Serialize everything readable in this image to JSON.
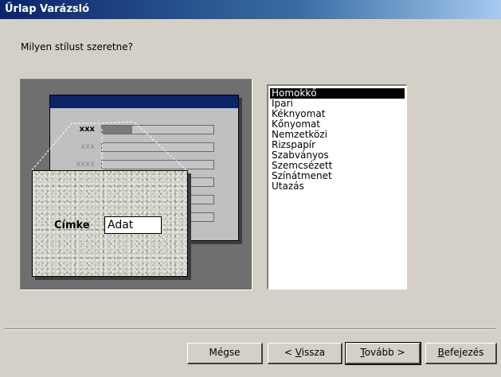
{
  "window": {
    "title": "Űrlap Varázsló"
  },
  "prompt": "Milyen stílust szeretne?",
  "preview": {
    "rows": [
      {
        "label": "xxx",
        "selected": true
      },
      {
        "label": "xxx",
        "selected": false
      },
      {
        "label": "xxxx",
        "selected": false
      },
      {
        "label": "",
        "selected": false
      },
      {
        "label": "",
        "selected": false
      },
      {
        "label": "",
        "selected": false
      }
    ],
    "zoom_label": "Címke",
    "zoom_value": "Adat"
  },
  "style_list": {
    "items": [
      "Homokkő",
      "Ipari",
      "Kéknyomat",
      "Kőnyomat",
      "Nemzetközi",
      "Rizspapír",
      "Szabványos",
      "Szemcsézett",
      "Színátmenet",
      "Utazás"
    ],
    "selected": "Homokkő"
  },
  "buttons": {
    "cancel": "Mégse",
    "back_prefix": "< ",
    "back_accel": "V",
    "back_rest": "issza",
    "next_accel": "T",
    "next_rest": "ovább >",
    "finish_accel": "B",
    "finish_rest": "efejezés"
  }
}
